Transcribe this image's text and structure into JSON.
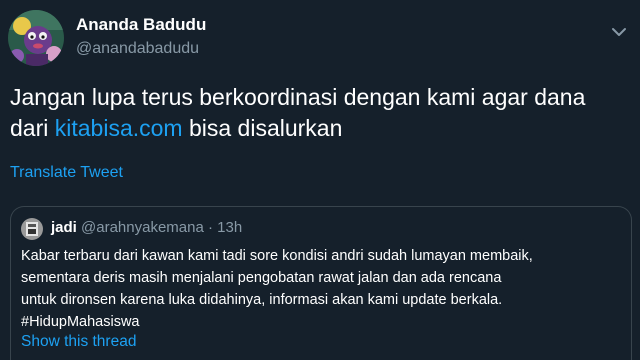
{
  "author": {
    "display_name": "Ananda Badudu",
    "handle": "@anandabadudu",
    "avatar_icon": "profile-avatar"
  },
  "tweet": {
    "text_line1": "Jangan lupa terus berkoordinasi dengan kami agar dana",
    "text_line2_prefix": "dari ",
    "link_text": "kitabisa.com",
    "text_line2_suffix": " bisa disalurkan",
    "translate_label": "Translate Tweet"
  },
  "quoted_tweet": {
    "display_name": "jadi",
    "handle": "@arahnyakemana",
    "separator": "·",
    "time": "13h",
    "lines": [
      "Kabar terbaru dari kawan kami tadi sore kondisi andri sudah lumayan membaik,",
      "sementara deris masih menjalani pengobatan rawat jalan dan ada rencana",
      "untuk dironsen karena luka didahinya, informasi akan kami update berkala.",
      "#HidupMahasiswa"
    ],
    "show_thread_label": "Show this thread"
  },
  "colors": {
    "background": "#15202b",
    "link": "#1da1f2",
    "secondary_text": "#8899a6",
    "border": "#38444d"
  }
}
